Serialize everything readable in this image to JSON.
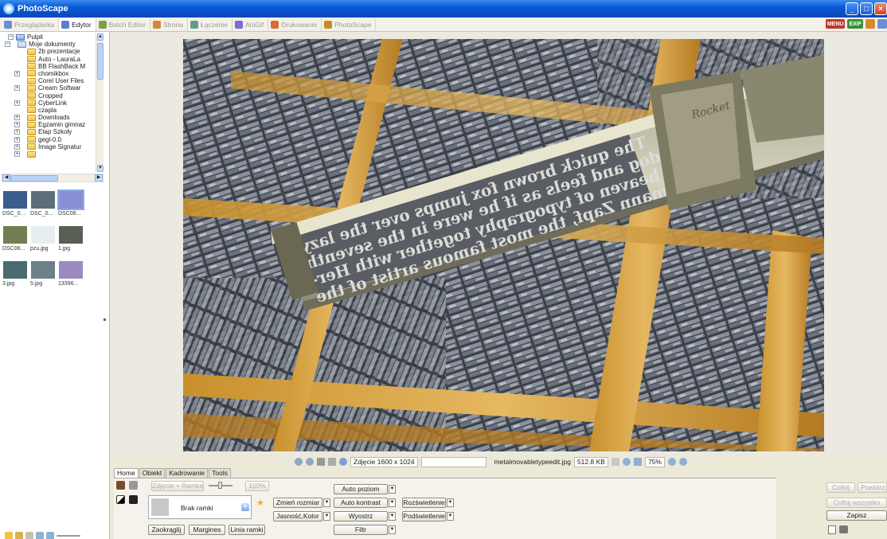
{
  "window": {
    "title": "PhotoScape"
  },
  "tabs": [
    {
      "label": "Przeglądarka",
      "active": false,
      "color": "#6b8fd6"
    },
    {
      "label": "Edytor",
      "active": true,
      "color": "#5a7fd0"
    },
    {
      "label": "Batch Editor",
      "active": false,
      "color": "#7aa04a"
    },
    {
      "label": "Strona",
      "active": false,
      "color": "#d08a3a"
    },
    {
      "label": "Łączenie",
      "active": false,
      "color": "#5f9d8a"
    },
    {
      "label": "AniGif",
      "active": false,
      "color": "#7b6ed0"
    },
    {
      "label": "Drukowanie",
      "active": false,
      "color": "#d96b3b"
    },
    {
      "label": "PhotoScape",
      "active": false,
      "color": "#c98a2c"
    }
  ],
  "tabbar_right": {
    "menu_label": "MENU",
    "exif_label": "EXIF"
  },
  "tree": {
    "root": "Pulpit",
    "items": [
      {
        "label": "Moje dokumenty",
        "level": 1,
        "expander": "−",
        "type": "docs"
      },
      {
        "label": "2b prezentacje",
        "level": 2,
        "expander": "",
        "type": "folder"
      },
      {
        "label": "Auto - LauraLa",
        "level": 2,
        "expander": "",
        "type": "folder"
      },
      {
        "label": "BB FlashBack M",
        "level": 2,
        "expander": "",
        "type": "folder"
      },
      {
        "label": "chomikbox",
        "level": 2,
        "expander": "+",
        "type": "folder"
      },
      {
        "label": "Corel User Files",
        "level": 2,
        "expander": "",
        "type": "folder"
      },
      {
        "label": "Cream Softwar",
        "level": 2,
        "expander": "+",
        "type": "folder"
      },
      {
        "label": "Cropped",
        "level": 2,
        "expander": "",
        "type": "folder"
      },
      {
        "label": "CyberLink",
        "level": 2,
        "expander": "+",
        "type": "folder"
      },
      {
        "label": "czapla",
        "level": 2,
        "expander": "",
        "type": "folder"
      },
      {
        "label": "Downloads",
        "level": 2,
        "expander": "+",
        "type": "folder"
      },
      {
        "label": "Egzamin gimnaz",
        "level": 2,
        "expander": "+",
        "type": "folder"
      },
      {
        "label": "Etap Szkoły",
        "level": 2,
        "expander": "+",
        "type": "folder"
      },
      {
        "label": "gegl-0.0",
        "level": 2,
        "expander": "+",
        "type": "folder"
      },
      {
        "label": "Image Signatur",
        "level": 2,
        "expander": "+",
        "type": "folder"
      },
      {
        "label": "",
        "level": 2,
        "expander": "+",
        "type": "folder"
      }
    ]
  },
  "thumbnails": [
    {
      "label": "DSC_0...",
      "color": "#3b5d8e",
      "selected": false
    },
    {
      "label": "DSC_0...",
      "color": "#5f6d7a",
      "selected": false
    },
    {
      "label": "DSC06...",
      "color": "#8a8fd4",
      "selected": true
    },
    {
      "label": "DSC06...",
      "color": "#6f7f4f",
      "selected": false
    },
    {
      "label": "pzu.jpg",
      "color": "#e6eef2",
      "selected": false
    },
    {
      "label": "1.jpg",
      "color": "#5a5f55",
      "selected": false
    },
    {
      "label": "3.jpg",
      "color": "#4b6b72",
      "selected": false
    },
    {
      "label": "5.jpg",
      "color": "#6d7f88",
      "selected": false
    },
    {
      "label": "13396...",
      "color": "#9a8bc0",
      "selected": false
    }
  ],
  "photo": {
    "engraved_text": [
      "The quick brown fox jumps over the lazy",
      "dog and feels as if he were in the seventh",
      "heaven of typography together with Her-",
      "mann Zapf, the most famous artist of the"
    ],
    "brand": "Rocket"
  },
  "status": {
    "photo_size": "Zdjęcie 1600 x 1024",
    "filename": "metalmovabletypeedit.jpg",
    "filesize": "512.8 KB",
    "zoom": "75%"
  },
  "bottom": {
    "tabs": [
      "Home",
      "Obiekt",
      "Kadrowanie",
      "Tools"
    ],
    "photo_frame_btn": "Zdjęcie + Ramka",
    "opacity": "100%",
    "frame_value": "Brak ramki",
    "round_btn": "Zaokrąglij",
    "margins_btn": "Margines",
    "line_btn": "Linia ramki",
    "resize_btn": "Zmień rozmiar",
    "brightness_btn": "Jasność,Kolor",
    "auto_level_btn": "Auto poziom",
    "auto_contrast_btn": "Auto kontrast",
    "sharpen_btn": "Wyostrz",
    "filter_btn": "Filtr",
    "brighten_btn": "Rozświetlenie",
    "backlight_btn": "Podświetlenie",
    "undo_btn": "Cofnij",
    "redo_btn": "Powtórz",
    "undo_all_btn": "Cofnij wszystko",
    "save_btn": "Zapisz"
  }
}
